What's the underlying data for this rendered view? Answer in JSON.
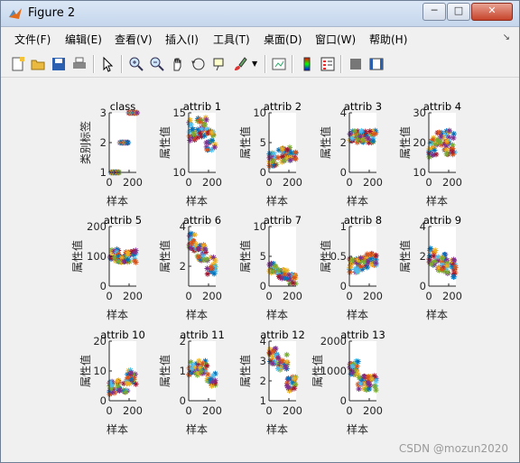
{
  "window": {
    "title": "Figure 2",
    "controls": [
      "minimize",
      "maximize",
      "close"
    ]
  },
  "menu": [
    {
      "label": "文件(F)",
      "name": "menu-file"
    },
    {
      "label": "编辑(E)",
      "name": "menu-edit"
    },
    {
      "label": "查看(V)",
      "name": "menu-view"
    },
    {
      "label": "插入(I)",
      "name": "menu-insert"
    },
    {
      "label": "工具(T)",
      "name": "menu-tools"
    },
    {
      "label": "桌面(D)",
      "name": "menu-desktop"
    },
    {
      "label": "窗口(W)",
      "name": "menu-window"
    },
    {
      "label": "帮助(H)",
      "name": "menu-help"
    }
  ],
  "toolbar": {
    "icons": [
      "new-figure-icon",
      "open-file-icon",
      "save-icon",
      "print-icon",
      "pointer-icon",
      "zoom-in-icon",
      "zoom-out-icon",
      "pan-icon",
      "rotate-3d-icon",
      "data-cursor-icon",
      "brush-icon",
      "link-plot-icon",
      "insert-colorbar-icon",
      "insert-legend-icon",
      "hide-plot-tools-icon",
      "show-plot-tools-icon"
    ]
  },
  "chart_data": {
    "type": "scatter",
    "x_label": "样本",
    "y_label_default": "属性值",
    "x_ticks": [
      "0",
      "200"
    ],
    "series_colors": [
      "#0072bd",
      "#d95319",
      "#edb120",
      "#7e2f8e",
      "#77ac30",
      "#4dbeee",
      "#a2142f"
    ],
    "subplots": [
      {
        "title": "class",
        "ylabel": "类别标签",
        "yticks": [
          "1",
          "2",
          "3"
        ],
        "ymin": 1,
        "ymax": 3,
        "kind": "class"
      },
      {
        "title": "attrib 1",
        "ylabel": "属性值",
        "yticks": [
          "10",
          "15"
        ],
        "ymin": 10,
        "ymax": 15,
        "kind": "cloud",
        "center": [
          0.7,
          0.75,
          0.55
        ],
        "spread": 0.18
      },
      {
        "title": "attrib 2",
        "ylabel": "属性值",
        "yticks": [
          "0",
          "5",
          "10"
        ],
        "ymin": 0,
        "ymax": 10,
        "kind": "cloud",
        "center": [
          0.22,
          0.28,
          0.32
        ],
        "spread": 0.12
      },
      {
        "title": "attrib 3",
        "ylabel": "属性值",
        "yticks": [
          "0",
          "2",
          "4"
        ],
        "ymin": 0,
        "ymax": 4,
        "kind": "cloud",
        "center": [
          0.6,
          0.6,
          0.6
        ],
        "spread": 0.1
      },
      {
        "title": "attrib 4",
        "ylabel": "属性值",
        "yticks": [
          "10",
          "20",
          "30"
        ],
        "ymin": 10,
        "ymax": 30,
        "kind": "cloud",
        "center": [
          0.4,
          0.55,
          0.5
        ],
        "spread": 0.2
      },
      {
        "title": "attrib 5",
        "ylabel": "属性值",
        "yticks": [
          "0",
          "100",
          "200"
        ],
        "ymin": 0,
        "ymax": 200,
        "kind": "cloud",
        "center": [
          0.52,
          0.48,
          0.5
        ],
        "spread": 0.1
      },
      {
        "title": "attrib 6",
        "ylabel": "属性值",
        "yticks": [
          "2",
          "4"
        ],
        "ymin": 1,
        "ymax": 4,
        "kind": "cloud",
        "center": [
          0.75,
          0.55,
          0.35
        ],
        "spread": 0.15
      },
      {
        "title": "attrib 7",
        "ylabel": "属性值",
        "yticks": [
          "0",
          "5",
          "10"
        ],
        "ymin": 0,
        "ymax": 10,
        "kind": "cloud",
        "center": [
          0.3,
          0.2,
          0.12
        ],
        "spread": 0.08
      },
      {
        "title": "attrib 8",
        "ylabel": "属性值",
        "yticks": [
          "0",
          "0.5",
          "1"
        ],
        "ymin": 0,
        "ymax": 1,
        "kind": "cloud",
        "center": [
          0.35,
          0.4,
          0.45
        ],
        "spread": 0.12
      },
      {
        "title": "attrib 9",
        "ylabel": "属性值",
        "yticks": [
          "0",
          "2",
          "4"
        ],
        "ymin": 0,
        "ymax": 4,
        "kind": "cloud",
        "center": [
          0.5,
          0.4,
          0.3
        ],
        "spread": 0.15
      },
      {
        "title": "attrib 10",
        "ylabel": "属性值",
        "yticks": [
          "0",
          "10",
          "20"
        ],
        "ymin": 0,
        "ymax": 20,
        "kind": "cloud",
        "center": [
          0.22,
          0.25,
          0.4
        ],
        "spread": 0.12
      },
      {
        "title": "attrib 11",
        "ylabel": "属性值",
        "yticks": [
          "0",
          "1",
          "2"
        ],
        "ymin": 0,
        "ymax": 2,
        "kind": "cloud",
        "center": [
          0.55,
          0.55,
          0.35
        ],
        "spread": 0.12
      },
      {
        "title": "attrib 12",
        "ylabel": "属性值",
        "yticks": [
          "1",
          "2",
          "3",
          "4"
        ],
        "ymin": 1,
        "ymax": 4,
        "kind": "cloud",
        "center": [
          0.75,
          0.65,
          0.3
        ],
        "spread": 0.13
      },
      {
        "title": "attrib 13",
        "ylabel": "属性值",
        "yticks": [
          "0",
          "1000",
          "2000"
        ],
        "ymin": 0,
        "ymax": 2000,
        "kind": "cloud",
        "center": [
          0.55,
          0.3,
          0.3
        ],
        "spread": 0.12
      }
    ]
  },
  "watermark": "CSDN @mozun2020"
}
